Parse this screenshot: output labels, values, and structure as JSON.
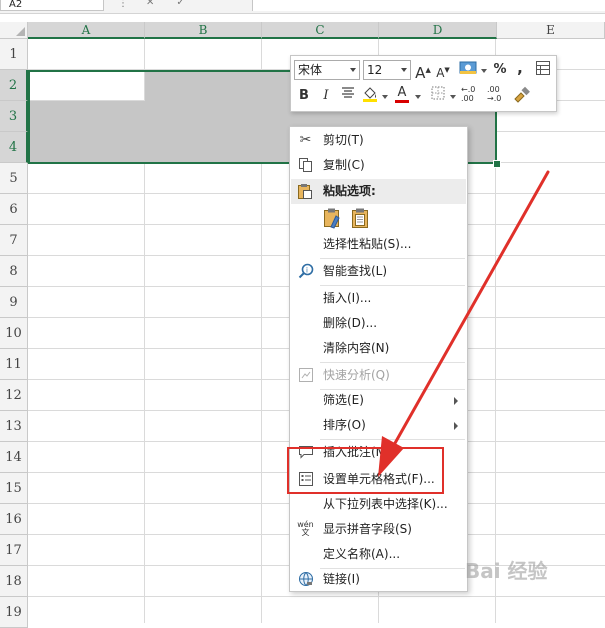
{
  "name_box": "A2",
  "columns": [
    "A",
    "B",
    "C",
    "D",
    "E"
  ],
  "rows": [
    "1",
    "2",
    "3",
    "4",
    "5",
    "6",
    "7",
    "8",
    "9",
    "10",
    "11",
    "12",
    "13",
    "14",
    "15",
    "16",
    "17",
    "18",
    "19"
  ],
  "mini_toolbar": {
    "font_name": "宋体",
    "font_size": "12",
    "grow_font": "A",
    "shrink_font": "A",
    "percent": "%",
    "comma": ",",
    "bold": "B",
    "italic": "I",
    "font_color": "A",
    "increase_decimal": "←.0\n.00",
    "decrease_decimal": ".00\n→.0"
  },
  "context_menu": {
    "cut": "剪切(T)",
    "copy": "复制(C)",
    "paste_options": "粘贴选项:",
    "paste_special": "选择性粘贴(S)...",
    "smart_lookup": "智能查找(L)",
    "insert": "插入(I)...",
    "delete": "删除(D)...",
    "clear_contents": "清除内容(N)",
    "quick_analysis": "快速分析(Q)",
    "filter": "筛选(E)",
    "sort": "排序(O)",
    "insert_comment": "插入批注(M)",
    "format_cells": "设置单元格格式(F)...",
    "pick_from_list": "从下拉列表中选择(K)...",
    "phonetic": "显示拼音字段(S)",
    "define_name": "定义名称(A)...",
    "link": "链接(I)"
  },
  "phonetic_icon_text": "wén\n文",
  "watermark": "Bai 经验",
  "colors": {
    "selection_border": "#217346",
    "selection_fill": "#c6c6c6",
    "annotation": "#e0302a",
    "font_color_bar": "#d80000",
    "fill_color_bar": "#ffe000"
  }
}
